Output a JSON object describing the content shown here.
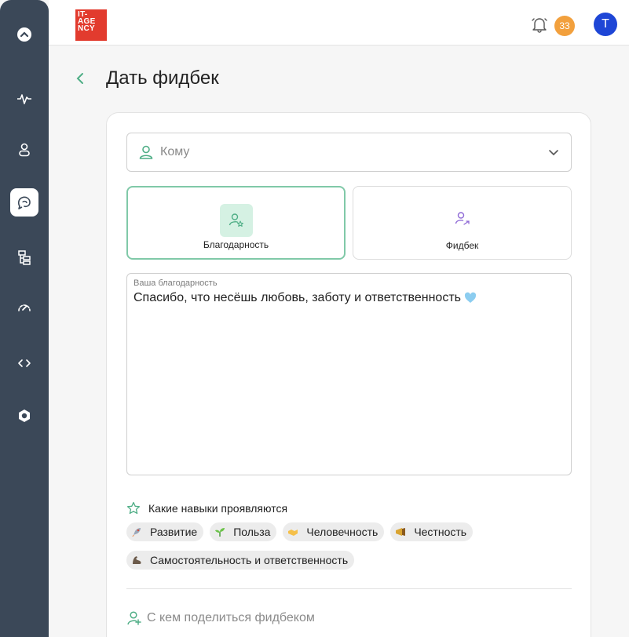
{
  "header": {
    "logo_lines": [
      "IT-",
      "AGE",
      "NCY"
    ],
    "notifications_count": "33",
    "avatar_initial": "T"
  },
  "page": {
    "title": "Дать фидбек"
  },
  "form": {
    "recipient_placeholder": "Кому",
    "types": [
      {
        "label": "Благодарность",
        "selected": true
      },
      {
        "label": "Фидбек",
        "selected": false
      }
    ],
    "message_label": "Ваша благодарность",
    "message_value": "Спасибо, что несёшь любовь, заботу и ответственность",
    "skills_title": "Какие навыки проявляются",
    "skills": [
      {
        "label": "Развитие",
        "icon": "rocket-icon"
      },
      {
        "label": "Польза",
        "icon": "sprout-icon"
      },
      {
        "label": "Человечность",
        "icon": "handshake-icon"
      },
      {
        "label": "Честность",
        "icon": "megaphone-icon"
      },
      {
        "label": "Самостоятельность и ответственность",
        "icon": "muscle-icon"
      }
    ],
    "share_label": "С кем поделиться фидбеком"
  },
  "colors": {
    "sidebar": "#3b4858",
    "accent": "#4fae86",
    "badge": "#f2a03d",
    "avatar": "#1e46d6",
    "logo": "#e23b2e"
  }
}
